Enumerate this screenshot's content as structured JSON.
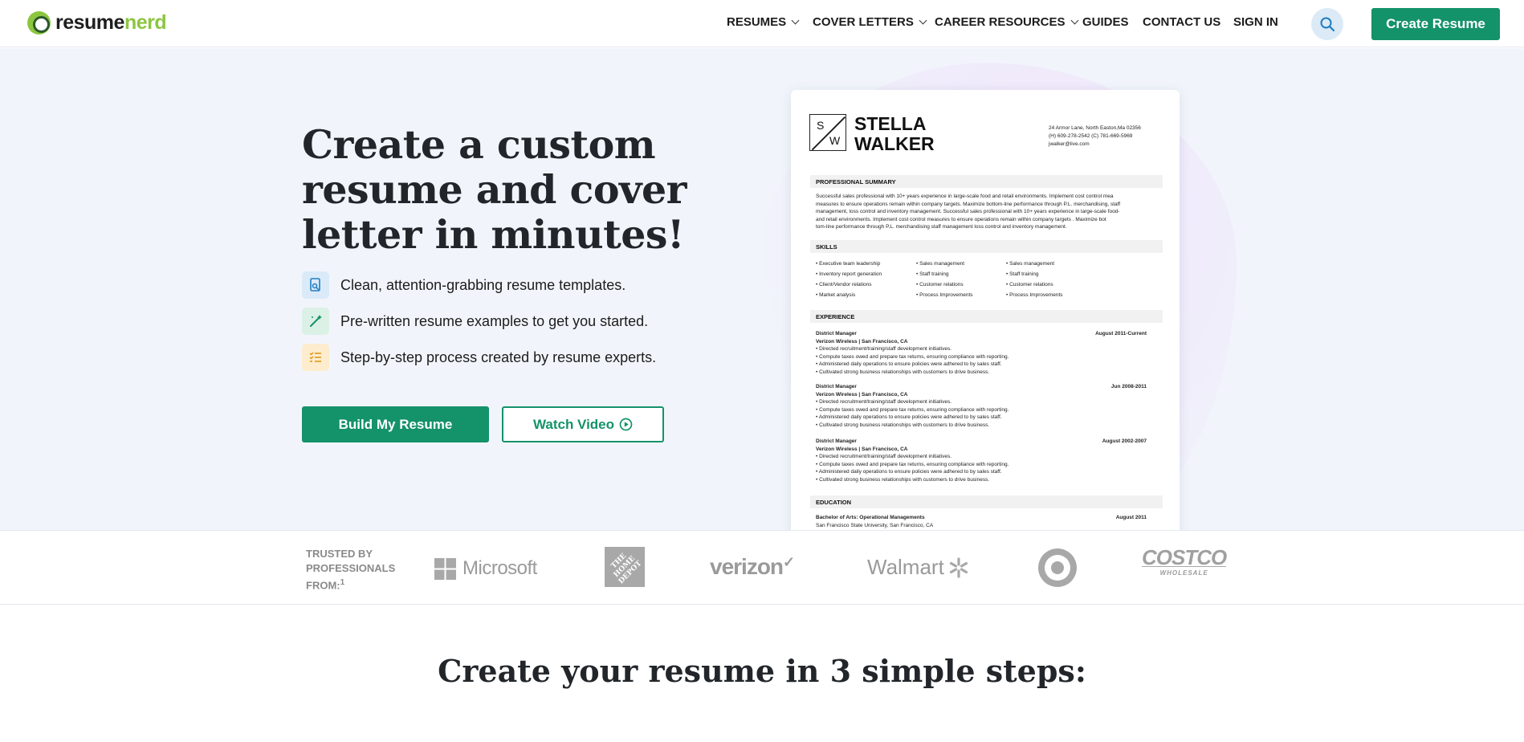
{
  "header": {
    "logo_part1": "resume",
    "logo_part2": "nerd",
    "nav": [
      {
        "label": "RESUMES"
      },
      {
        "label": "COVER LETTERS"
      },
      {
        "label": "CAREER RESOURCES"
      },
      {
        "label": "GUIDES"
      },
      {
        "label": "CONTACT US"
      },
      {
        "label": "SIGN IN"
      }
    ],
    "search_icon": "search-icon",
    "cta_label": "Create Resume"
  },
  "hero": {
    "headline": "Create a custom resume and cover letter in minutes!",
    "features": [
      {
        "icon": "template-icon",
        "text": "Clean, attention-grabbing resume templates."
      },
      {
        "icon": "magic-wand-icon",
        "text": "Pre-written resume examples to get you started."
      },
      {
        "icon": "checklist-icon",
        "text": "Step-by-step process created by resume experts."
      }
    ],
    "primary_button": "Build My Resume",
    "secondary_button": "Watch Video"
  },
  "resume": {
    "monogram_s": "S",
    "monogram_w": "W",
    "first_name": "STELLA",
    "last_name": "WALKER",
    "address": "24 Armor Lane, North Easton,Ma 02356",
    "phone": "(H) 609-278-2542 (C) 781-669-5969",
    "email": "jwalker@live.com",
    "summary_title": "PROFESSIONAL SUMMARY",
    "summary_lines": [
      "Successful sales professional with 10+ years experience in large-scale food and retail environments. Implement cost control mea",
      "measures to ensure operations remain within company targets. Maximize bottom-line performance through P.L. merchandising, staff",
      "management, loss control and inventory management. Successful sales professional with 10+ years experience in large-scale food-",
      "and retail environments. Implement cost control measures to ensure operations remain within company targets . Maximize bot",
      "tom-line performance through P.L. merchandising staff management loss control and inventory management."
    ],
    "skills_title": "SKILLS",
    "skills_col1": [
      "Executive team leadership",
      "Inventory report generation",
      "Client/Vendor relations",
      "Market analysis"
    ],
    "skills_col2": [
      "Sales management",
      "Staff training",
      "Customer relations",
      "Process Improvements"
    ],
    "skills_col3": [
      "Sales management",
      "Staff training",
      "Customer relations",
      "Process Improvements"
    ],
    "experience_title": "EXPERIENCE",
    "jobs": [
      {
        "title": "District Manager",
        "company": "Verizon Wireless | San Francisco, CA",
        "dates": "August 2011-Current"
      },
      {
        "title": "District Manager",
        "company": "Verizon Wireless | San Francisco, CA",
        "dates": "Jun 2008-2011"
      },
      {
        "title": "District Manager",
        "company": "Verizon Wireless | San Francisco, CA",
        "dates": "August 2002-2007"
      }
    ],
    "job_bullets": [
      "Directed recruitment/training/staff development initiatives.",
      "Compute taxes owed and prepare tax returns, ensuring compliance with reporting.",
      "Administered daily operations to ensure policies were adhered to by sales staff.",
      "Cultivated strong business relationships with customers to drive business."
    ],
    "education_title": "EDUCATION",
    "degree": "Bachelor of Arts: Operational Managements",
    "school": "San Francisco State University, San Francisco, CA",
    "edu_date": "August 2011"
  },
  "trusted": {
    "label": "TRUSTED BY PROFESSIONALS FROM:",
    "footnote": "1",
    "brands": [
      "Microsoft",
      "THE HOME DEPOT",
      "verizon",
      "Walmart",
      "Target",
      "COSTCO",
      "WHOLESALE"
    ]
  },
  "steps_heading": "Create your resume in 3 simple steps:",
  "colors": {
    "accent": "#14926a",
    "logo_green": "#8cc63f",
    "hero_bg": "#f1f5fb"
  }
}
